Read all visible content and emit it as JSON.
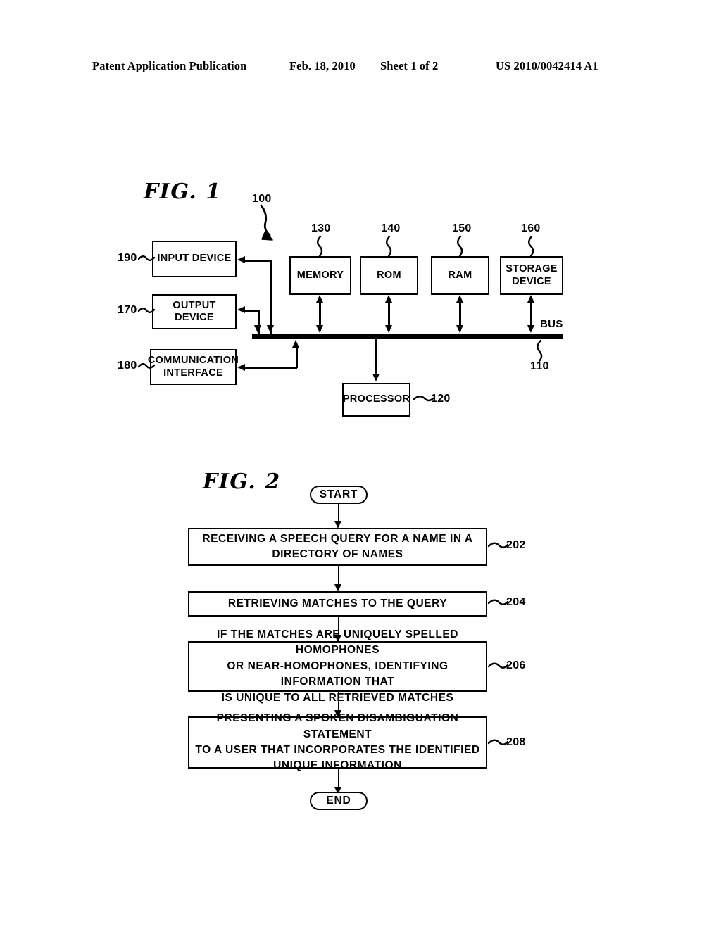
{
  "header": {
    "publication": "Patent Application Publication",
    "date": "Feb. 18, 2010",
    "sheet": "Sheet 1 of 2",
    "patent_number": "US 2010/0042414 A1"
  },
  "figure1": {
    "title": "FIG. 1",
    "system_ref": "100",
    "bus_label": "BUS",
    "bus_ref": "110",
    "blocks": [
      {
        "id": "input-device",
        "label": "INPUT\nDEVICE",
        "ref": "190"
      },
      {
        "id": "output-device",
        "label": "OUTPUT\nDEVICE",
        "ref": "170"
      },
      {
        "id": "communication-interface",
        "label": "COMMUNICATION\nINTERFACE",
        "ref": "180"
      },
      {
        "id": "memory",
        "label": "MEMORY",
        "ref": "130"
      },
      {
        "id": "rom",
        "label": "ROM",
        "ref": "140"
      },
      {
        "id": "ram",
        "label": "RAM",
        "ref": "150"
      },
      {
        "id": "storage-device",
        "label": "STORAGE\nDEVICE",
        "ref": "160"
      },
      {
        "id": "processor",
        "label": "PROCESSOR",
        "ref": "120"
      }
    ],
    "labels": {
      "input_line1": "INPUT",
      "input_line2": "DEVICE",
      "output_line1": "OUTPUT",
      "output_line2": "DEVICE",
      "comm_line1": "COMMUNICATION",
      "comm_line2": "INTERFACE",
      "memory": "MEMORY",
      "rom": "ROM",
      "ram": "RAM",
      "storage_line1": "STORAGE",
      "storage_line2": "DEVICE",
      "processor": "PROCESSOR"
    },
    "refs": {
      "input": "190",
      "output": "170",
      "comm": "180",
      "memory": "130",
      "rom": "140",
      "ram": "150",
      "storage": "160",
      "processor": "120",
      "system": "100",
      "bus": "110"
    }
  },
  "figure2": {
    "title": "FIG. 2",
    "start_label": "START",
    "end_label": "END",
    "steps": [
      {
        "ref": "202",
        "lines": [
          "RECEIVING A SPEECH QUERY FOR A NAME IN A",
          "DIRECTORY OF NAMES"
        ]
      },
      {
        "ref": "204",
        "lines": [
          "RETRIEVING MATCHES TO THE QUERY"
        ]
      },
      {
        "ref": "206",
        "lines": [
          "IF THE MATCHES ARE UNIQUELY SPELLED HOMOPHONES",
          "OR NEAR-HOMOPHONES, IDENTIFYING INFORMATION THAT",
          "IS UNIQUE TO ALL RETRIEVED MATCHES"
        ]
      },
      {
        "ref": "208",
        "lines": [
          "PRESENTING A SPOKEN DISAMBIGUATION STATEMENT",
          "TO A USER THAT INCORPORATES THE IDENTIFIED",
          "UNIQUE INFORMATION"
        ]
      }
    ],
    "step_text": {
      "s202_l1": "RECEIVING A SPEECH QUERY FOR A NAME IN A",
      "s202_l2": "DIRECTORY OF NAMES",
      "s204_l1": "RETRIEVING MATCHES TO THE QUERY",
      "s206_l1": "IF THE MATCHES ARE UNIQUELY SPELLED HOMOPHONES",
      "s206_l2": "OR NEAR-HOMOPHONES, IDENTIFYING INFORMATION THAT",
      "s206_l3": "IS UNIQUE TO ALL RETRIEVED MATCHES",
      "s208_l1": "PRESENTING A SPOKEN DISAMBIGUATION STATEMENT",
      "s208_l2": "TO A USER THAT INCORPORATES THE IDENTIFIED",
      "s208_l3": "UNIQUE INFORMATION"
    },
    "step_refs": {
      "s202": "202",
      "s204": "204",
      "s206": "206",
      "s208": "208"
    }
  },
  "colors": {
    "ink": "#000000",
    "paper": "#ffffff"
  }
}
